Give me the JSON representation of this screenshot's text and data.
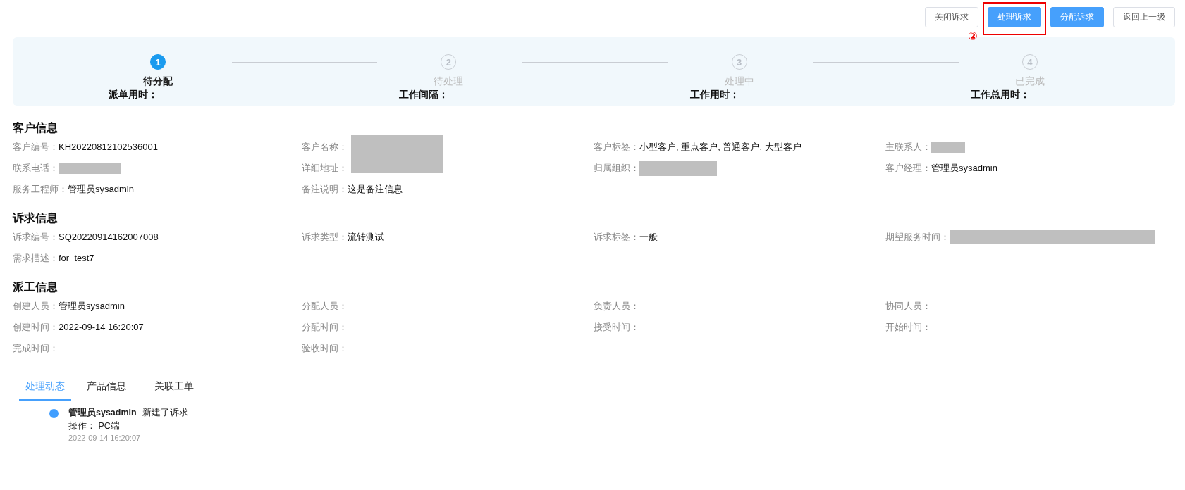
{
  "buttons": [
    {
      "label": "关闭诉求",
      "kind": "default",
      "highlighted": false
    },
    {
      "label": "处理诉求",
      "kind": "primary",
      "highlighted": true
    },
    {
      "label": "分配诉求",
      "kind": "primary",
      "highlighted": false
    },
    {
      "label": "返回上一级",
      "kind": "default",
      "highlighted": false
    }
  ],
  "annotation": {
    "label": "②"
  },
  "steps": [
    {
      "number": "1",
      "title": "待分配",
      "selected": true,
      "duration_label": "派单用时："
    },
    {
      "number": "2",
      "title": "待处理",
      "selected": false,
      "duration_label": "工作间隔："
    },
    {
      "number": "3",
      "title": "处理中",
      "selected": false,
      "duration_label": "工作用时："
    },
    {
      "number": "4",
      "title": "已完成",
      "selected": false,
      "duration_label": "工作总用时："
    }
  ],
  "sections": [
    {
      "title": "客户信息",
      "fields": [
        {
          "label": "客户编号：",
          "kind": "text",
          "value": "KH20220812102536001"
        },
        {
          "label": "客户名称：",
          "kind": "redacted-tall"
        },
        {
          "label": "客户标签：",
          "kind": "text",
          "value": "小型客户, 重点客户, 普通客户, 大型客户"
        },
        {
          "label": "主联系人：",
          "kind": "redacted-short"
        },
        {
          "label": "联系电话：",
          "kind": "redacted-medium"
        },
        {
          "label": "详细地址：",
          "kind": "empty"
        },
        {
          "label": "归属组织：",
          "kind": "redacted-wide"
        },
        {
          "label": "客户经理：",
          "kind": "text",
          "value": "管理员sysadmin"
        },
        {
          "label": "服务工程师：",
          "kind": "text",
          "value": "管理员sysadmin"
        },
        {
          "label": "备注说明：",
          "kind": "text",
          "value": "这是备注信息"
        }
      ]
    },
    {
      "title": "诉求信息",
      "fields": [
        {
          "label": "诉求编号：",
          "kind": "text",
          "value": "SQ20220914162007008"
        },
        {
          "label": "诉求类型：",
          "kind": "text",
          "value": "流转测试"
        },
        {
          "label": "诉求标签：",
          "kind": "text",
          "value": "一般"
        },
        {
          "label": "期望服务时间：",
          "kind": "redacted-long"
        },
        {
          "label": "需求描述：",
          "kind": "text",
          "value": "for_test7"
        }
      ]
    },
    {
      "title": "派工信息",
      "fields": [
        {
          "label": "创建人员：",
          "kind": "text",
          "value": "管理员sysadmin"
        },
        {
          "label": "分配人员：",
          "kind": "empty"
        },
        {
          "label": "负责人员：",
          "kind": "empty"
        },
        {
          "label": "协同人员：",
          "kind": "empty"
        },
        {
          "label": "创建时间：",
          "kind": "text",
          "value": "2022-09-14 16:20:07"
        },
        {
          "label": "分配时间：",
          "kind": "empty"
        },
        {
          "label": "接受时间：",
          "kind": "empty"
        },
        {
          "label": "开始时间：",
          "kind": "empty"
        },
        {
          "label": "完成时间：",
          "kind": "empty"
        },
        {
          "label": "验收时间：",
          "kind": "empty"
        }
      ]
    }
  ],
  "tabs": [
    {
      "label": "处理动态",
      "selected": true
    },
    {
      "label": "产品信息",
      "selected": false
    },
    {
      "label": "关联工单",
      "selected": false
    }
  ],
  "timeline": [
    {
      "user": "管理员sysadmin",
      "action": "新建了诉求",
      "operation": "操作： PC端",
      "time": "2022-09-14 16:20:07"
    }
  ]
}
